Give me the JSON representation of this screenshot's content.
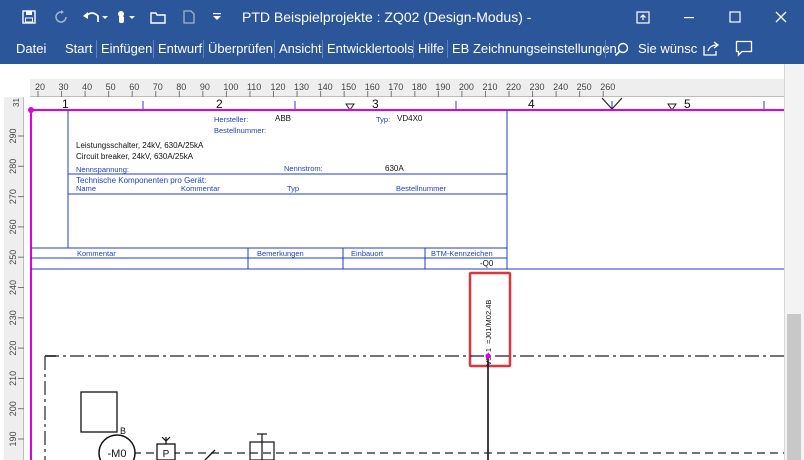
{
  "titlebar": {
    "title": "PTD Beispielprojekte : ZQ02 (Design-Modus)  -",
    "icons": [
      "save-icon",
      "redo-icon",
      "undo-icon",
      "touch-mode-icon",
      "open-folder-icon",
      "new-file-icon",
      "customize-icon"
    ],
    "window_controls": [
      "ribbon-display-icon",
      "minimize-icon",
      "maximize-icon",
      "close-icon"
    ]
  },
  "menu": {
    "items": [
      "Datei",
      "Start",
      "Einfügen",
      "Entwurf",
      "Überprüfen",
      "Ansicht",
      "Entwicklertools",
      "Hilfe",
      "EB Zeichnungseinstellungen"
    ],
    "search_label": "Sie wünsc",
    "search_icon": "search-icon",
    "share_icon": "share-icon",
    "comment_icon": "comment-icon"
  },
  "ruler": {
    "h_ticks": [
      "20",
      "30",
      "40",
      "50",
      "60",
      "70",
      "80",
      "90",
      "100",
      "110",
      "120",
      "130",
      "140",
      "150",
      "160",
      "170",
      "180",
      "190",
      "200",
      "210",
      "220",
      "230",
      "240",
      "250",
      "260"
    ],
    "v_ticks": [
      "290",
      "280",
      "270",
      "260",
      "250",
      "240",
      "230",
      "220",
      "210",
      "200",
      "190"
    ],
    "v_top": "31"
  },
  "columns": [
    "1",
    "2",
    "3",
    "4",
    "5"
  ],
  "device": {
    "hersteller_label": "Hersteller:",
    "hersteller_value": "ABB",
    "typ_label": "Typ:",
    "typ_value": "VD4X0",
    "bestellnummer_label": "Bestellnummer:",
    "desc_de": "Leistungsschalter, 24kV, 630A/25kA",
    "desc_en": "Circuit breaker, 24kV, 630A/25kA",
    "nennspannung_label": "Nennspannung:",
    "nennstrom_label": "Nennstrom:",
    "nennstrom_value": "630A",
    "components_title": "Technische Komponenten pro Gerät:",
    "comp_headers": [
      "Name",
      "Kommentar",
      "Typ",
      "Bestellnummer"
    ],
    "footer_headers": [
      "Kommentar",
      "Bemerkungen",
      "Einbauort",
      "BTM-Kennzeichen"
    ],
    "btm_value": "-Q0"
  },
  "highlight": {
    "label_line1": "=J01/M02.4B",
    "label_line2": "V3~1"
  },
  "symbols": {
    "motor_label": "-M0",
    "b_label": "B",
    "p_label": "P"
  },
  "colors": {
    "brand": "#2b579a",
    "drawing_blue": "#1f3fc5",
    "magenta": "#e000e0",
    "highlight": "#d9363e"
  }
}
